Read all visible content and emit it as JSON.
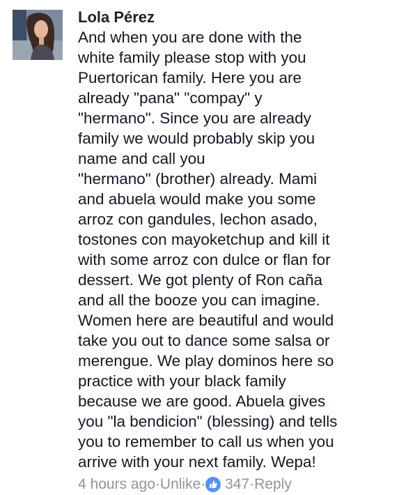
{
  "comment": {
    "author": "Lola Pérez",
    "avatar_icon": "profile-photo",
    "body_lines": [
      "And when you are done with the",
      "white family please stop with you",
      "Puertorican family. Here you are",
      "already \"pana\" \"compay\" y",
      "\"hermano\". Since you are already",
      "family we would probably skip you",
      "name and call you",
      "\"hermano\" (brother) already. Mami",
      "and abuela would make you some",
      "arroz con gandules, lechon asado,",
      "tostones con mayoketchup and kill it",
      "with some arroz con dulce or flan for",
      "dessert. We got plenty of Ron caña",
      "and all the booze you can imagine.",
      "Women here are beautiful and would",
      "take you out to dance some salsa or",
      "merengue. We play dominos here so",
      "practice with your black family",
      "because we are good. Abuela gives",
      "you \"la bendicion\" (blessing) and tells",
      "you to remember to call us when you",
      "arrive with your next family. Wepa!"
    ],
    "actions": {
      "timestamp": "4 hours ago",
      "separator": " · ",
      "unlike_label": "Unlike",
      "like_icon": "thumbs-up-icon",
      "like_count": "347",
      "reply_label": "Reply"
    }
  }
}
